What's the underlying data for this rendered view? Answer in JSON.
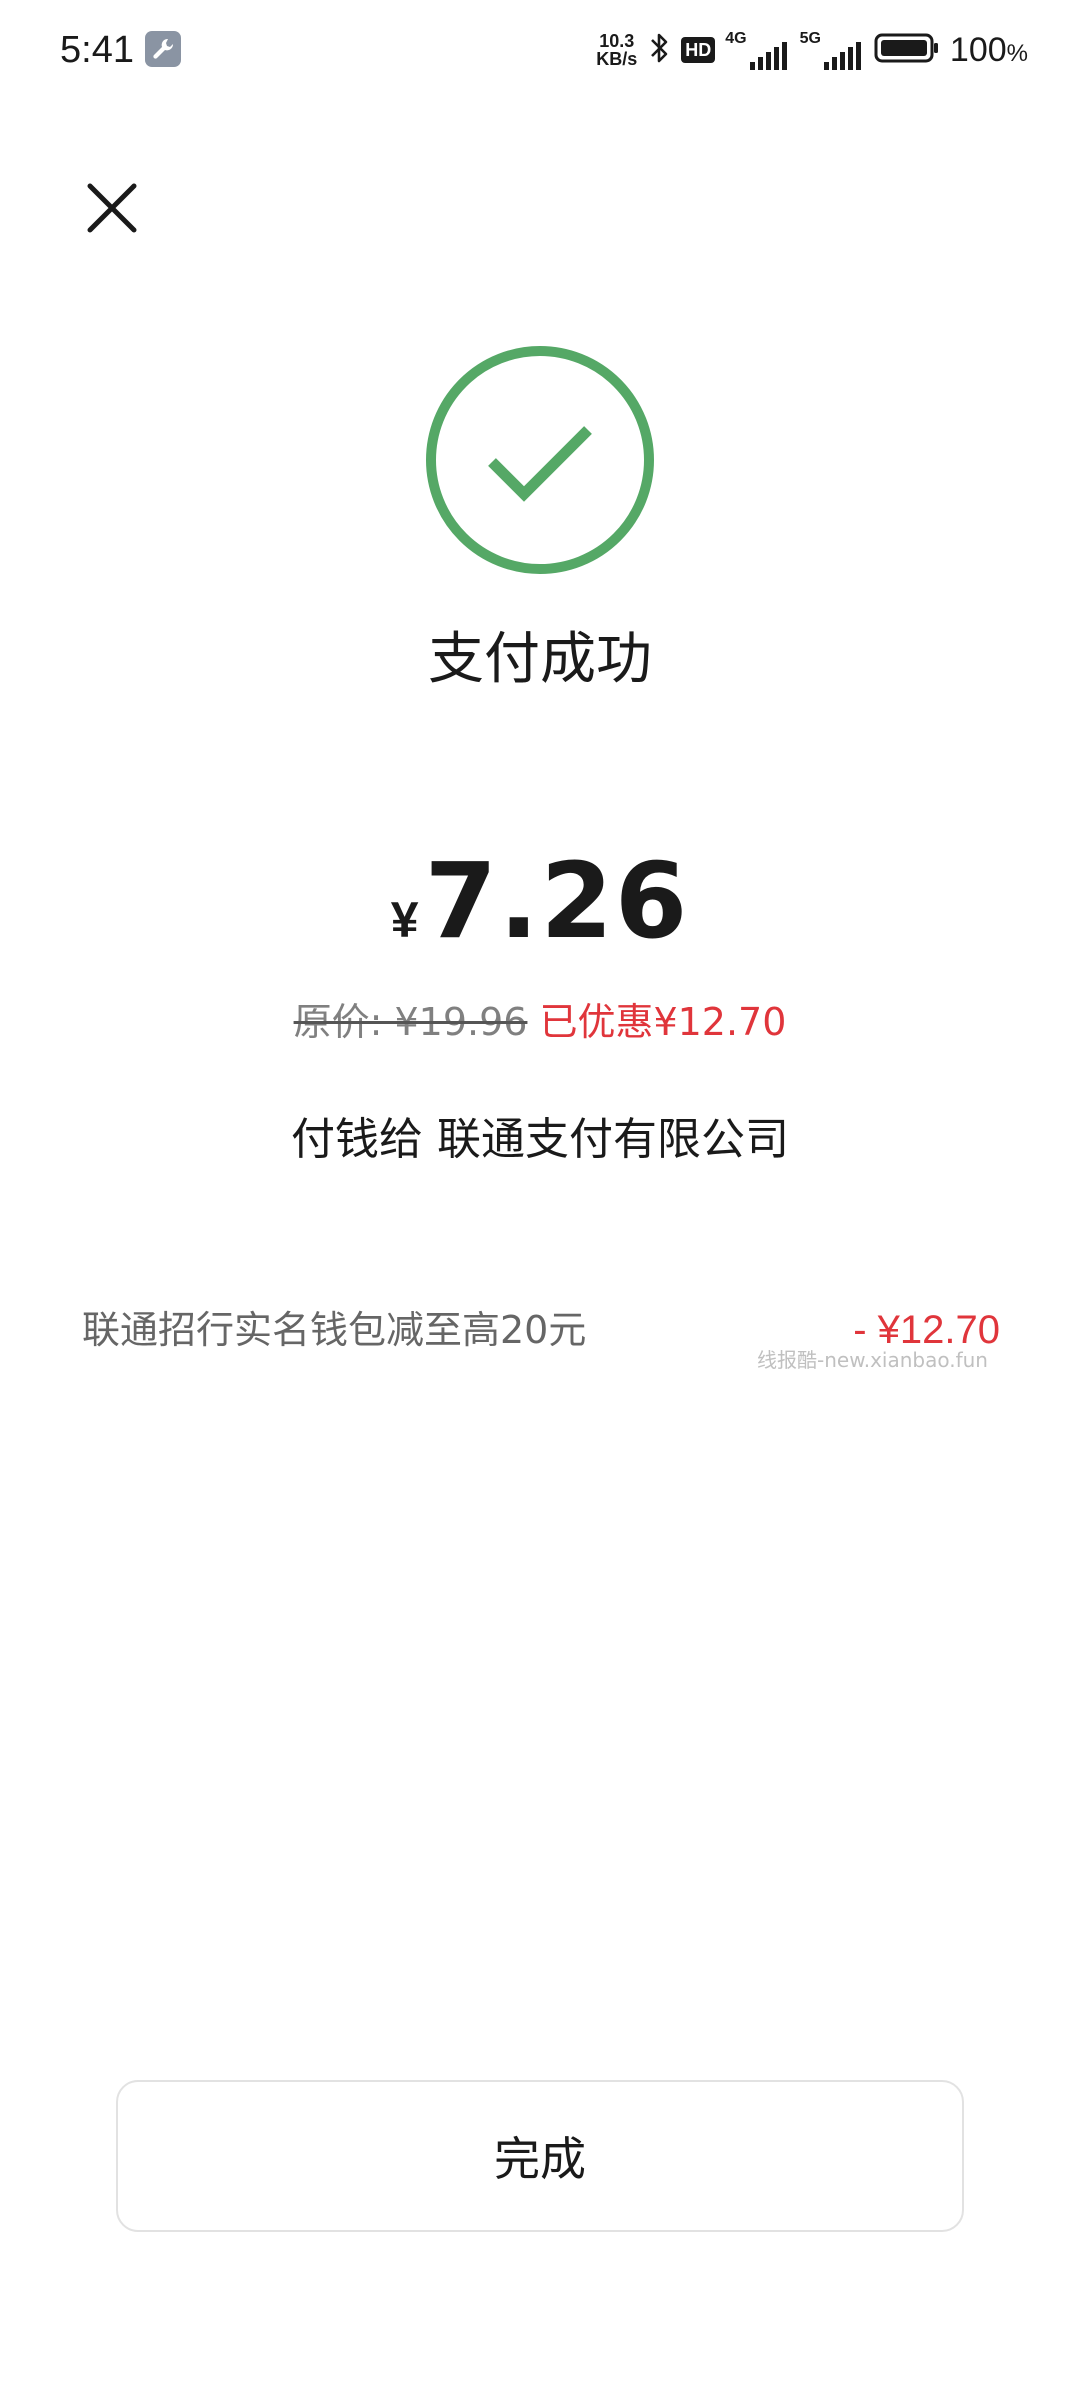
{
  "status_bar": {
    "time": "5:41",
    "net_speed_value": "10.3",
    "net_speed_unit": "KB/s",
    "hd_label": "HD",
    "signal1_tech": "4G",
    "signal2_tech": "5G",
    "battery_percent": "100",
    "battery_percent_sign": "%",
    "icons": [
      "wrench-app-icon",
      "bluetooth-icon",
      "hd-voice-icon",
      "signal-icon",
      "signal-icon",
      "battery-icon"
    ]
  },
  "header": {
    "close_icon": "close-icon"
  },
  "result": {
    "icon": "check-circle-icon",
    "icon_color": "#55a866",
    "title": "支付成功"
  },
  "payment": {
    "currency_symbol": "¥",
    "amount": "7.26",
    "original_price": "原价: ¥19.96",
    "discount": "已优惠¥12.70",
    "payee": "付钱给 联通支付有限公司"
  },
  "promotion": {
    "label": "联通招行实名钱包减至高20元",
    "amount": "- ¥12.70",
    "watermark": "线报酷-new.xianbao.fun"
  },
  "actions": {
    "done_label": "完成"
  },
  "colors": {
    "accent_red": "#e0353b",
    "success_green": "#55a866"
  }
}
